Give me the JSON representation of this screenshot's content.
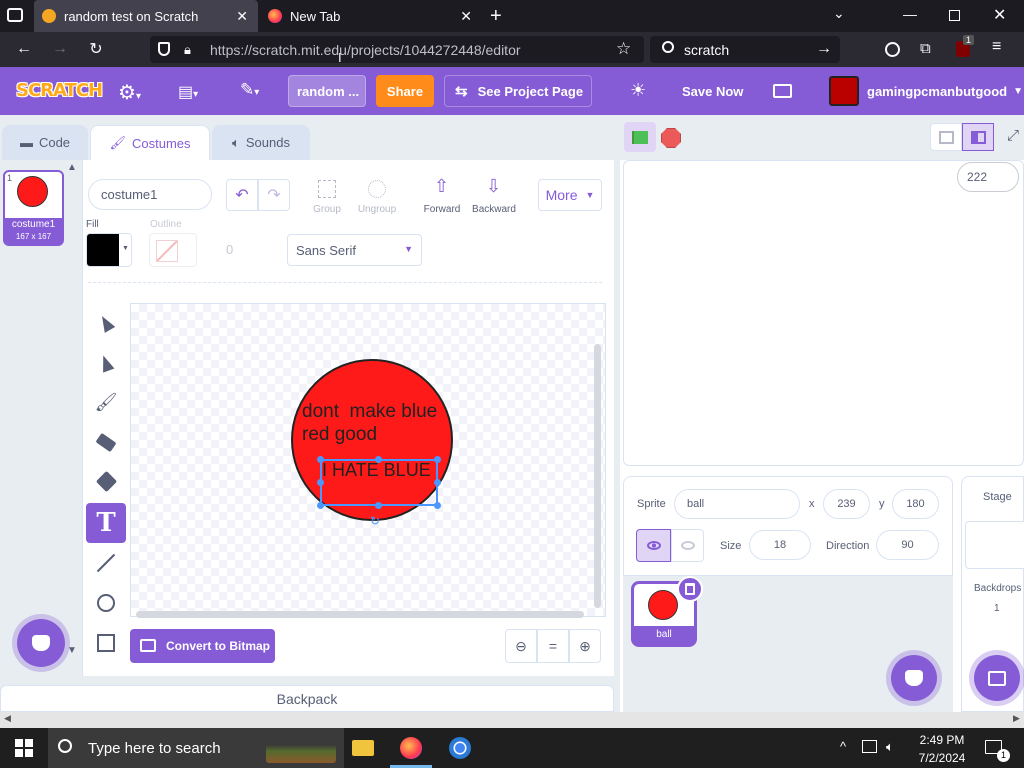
{
  "browser": {
    "tabs": [
      {
        "label": "random test on Scratch"
      },
      {
        "label": "New Tab"
      }
    ],
    "url": "https://scratch.mit.edu/projects/1044272448/editor",
    "search_value": "scratch",
    "extension_badge": "1"
  },
  "menu": {
    "logo": "SCRATCH",
    "project_title": "random ...",
    "share": "Share",
    "see_project_page": "See Project Page",
    "save_now": "Save Now",
    "username": "gamingpcmanbutgood"
  },
  "editor_tabs": [
    {
      "label": "Code"
    },
    {
      "label": "Costumes"
    },
    {
      "label": "Sounds"
    }
  ],
  "costume_list": [
    {
      "index": "1",
      "name": "costume1",
      "size": "167 x 167"
    }
  ],
  "paint": {
    "costume_name": "costume1",
    "group": "Group",
    "ungroup": "Ungroup",
    "forward": "Forward",
    "backward": "Backward",
    "more": "More",
    "fill_label": "Fill",
    "outline_label": "Outline",
    "outline_width": "0",
    "font": "Sans Serif",
    "convert": "Convert to Bitmap",
    "fill_color": "#000000"
  },
  "canvas": {
    "text1": "dont  make blue",
    "text2": "red good",
    "text3": "I HATE BLUE",
    "circle_color": "#ff1a1a"
  },
  "backpack": "Backpack",
  "stage": {
    "bubble": "222"
  },
  "sprite_info": {
    "sprite_label": "Sprite",
    "name": "ball",
    "x_label": "x",
    "x": "239",
    "y_label": "y",
    "y": "180",
    "size_label": "Size",
    "size": "18",
    "direction_label": "Direction",
    "direction": "90"
  },
  "sprites": [
    {
      "name": "ball"
    }
  ],
  "stage_panel": {
    "title": "Stage",
    "backdrops_label": "Backdrops",
    "backdrops_count": "1"
  },
  "taskbar": {
    "search_placeholder": "Type here to search",
    "time": "2:49 PM",
    "date": "7/2/2024",
    "notif_count": "1"
  },
  "colors": {
    "scratch_purple": "#855cd6",
    "share_orange": "#ff8c1a",
    "selection_blue": "#4c97ff"
  }
}
